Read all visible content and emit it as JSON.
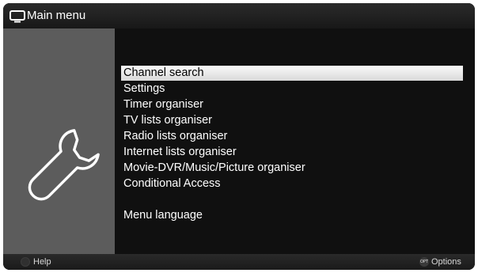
{
  "header": {
    "icon": "tv-icon",
    "title": "Main menu"
  },
  "sidebar": {
    "icon": "wrench-icon"
  },
  "menu": {
    "selected_index": 0,
    "items": [
      {
        "label": "Channel search"
      },
      {
        "label": "Settings"
      },
      {
        "label": "Timer organiser"
      },
      {
        "label": "TV lists organiser"
      },
      {
        "label": "Radio lists organiser"
      },
      {
        "label": "Internet lists organiser"
      },
      {
        "label": "Movie-DVR/Music/Picture organiser"
      },
      {
        "label": "Conditional Access"
      },
      {
        "label": "Menu language"
      }
    ]
  },
  "footer": {
    "help_label": "Help",
    "options_badge": "OPT",
    "options_label": "Options"
  },
  "colors": {
    "background": "#141414",
    "sidebar": "#5c5c5c",
    "selection": "#e6e6e6",
    "text": "#ffffff"
  }
}
